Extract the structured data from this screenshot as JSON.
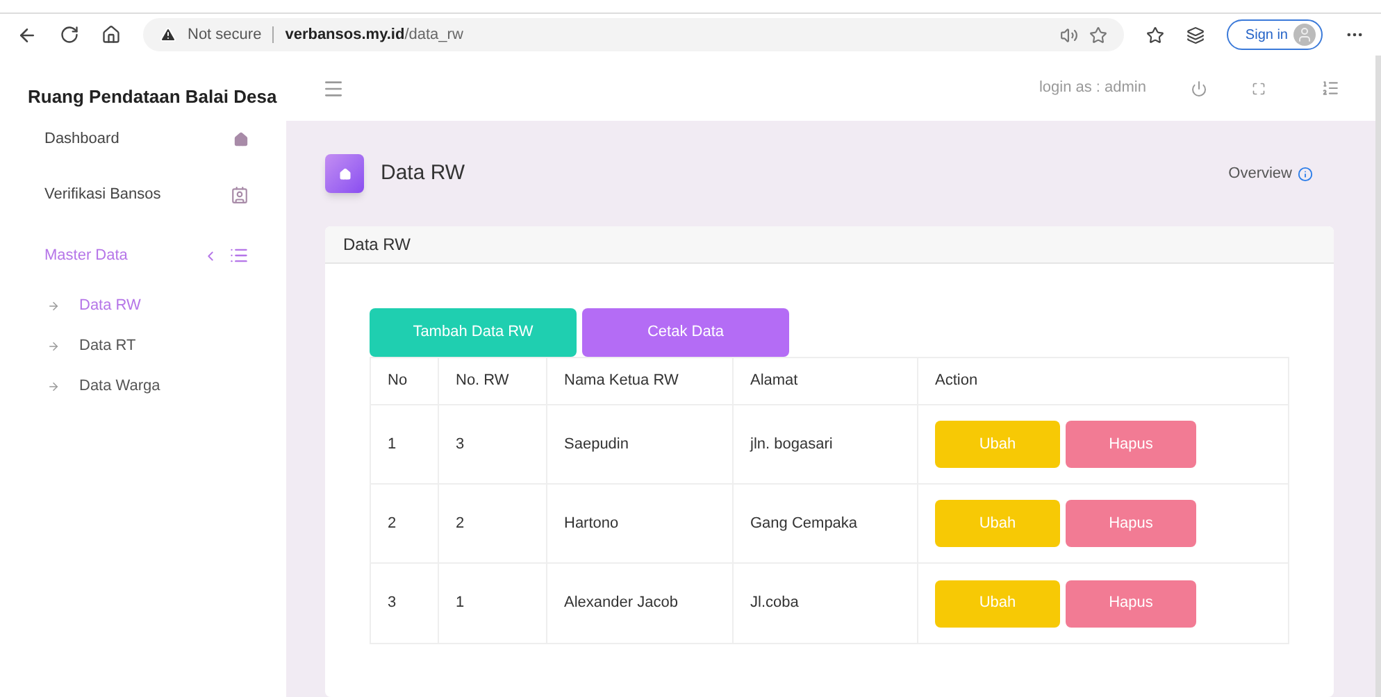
{
  "browser": {
    "security": "Not secure",
    "url_host": "verbansos.my.id",
    "url_path": "/data_rw",
    "sign_in": "Sign in"
  },
  "sidebar": {
    "title": "Ruang Pendataan Balai Desa",
    "items": [
      {
        "label": "Dashboard",
        "kind": "home",
        "selected": false
      },
      {
        "label": "Verifikasi Bansos",
        "kind": "contact",
        "selected": false
      },
      {
        "label": "Master Data",
        "kind": "list",
        "selected": true,
        "expanded": true,
        "children": [
          {
            "label": "Data RW",
            "selected": true
          },
          {
            "label": "Data RT",
            "selected": false
          },
          {
            "label": "Data Warga",
            "selected": false
          }
        ]
      }
    ]
  },
  "topbar": {
    "login": "login as : admin"
  },
  "page": {
    "title": "Data RW",
    "overview": "Overview"
  },
  "card": {
    "title": "Data RW",
    "buttons": [
      {
        "label": "Tambah Data RW",
        "kind": "add"
      },
      {
        "label": "Cetak Data",
        "kind": "print"
      }
    ],
    "table": {
      "columns": [
        "No",
        "No. RW",
        "Nama Ketua RW",
        "Alamat",
        "Action"
      ],
      "rows": [
        {
          "cells": [
            "1",
            "3",
            "Saepudin",
            "jln. bogasari"
          ],
          "actions": [
            "Ubah",
            "Hapus"
          ]
        },
        {
          "cells": [
            "2",
            "2",
            "Hartono",
            "Gang Cempaka"
          ],
          "actions": [
            "Ubah",
            "Hapus"
          ]
        },
        {
          "cells": [
            "3",
            "1",
            "Alexander Jacob",
            "Jl.coba"
          ],
          "actions": [
            "Ubah",
            "Hapus"
          ]
        }
      ]
    }
  }
}
